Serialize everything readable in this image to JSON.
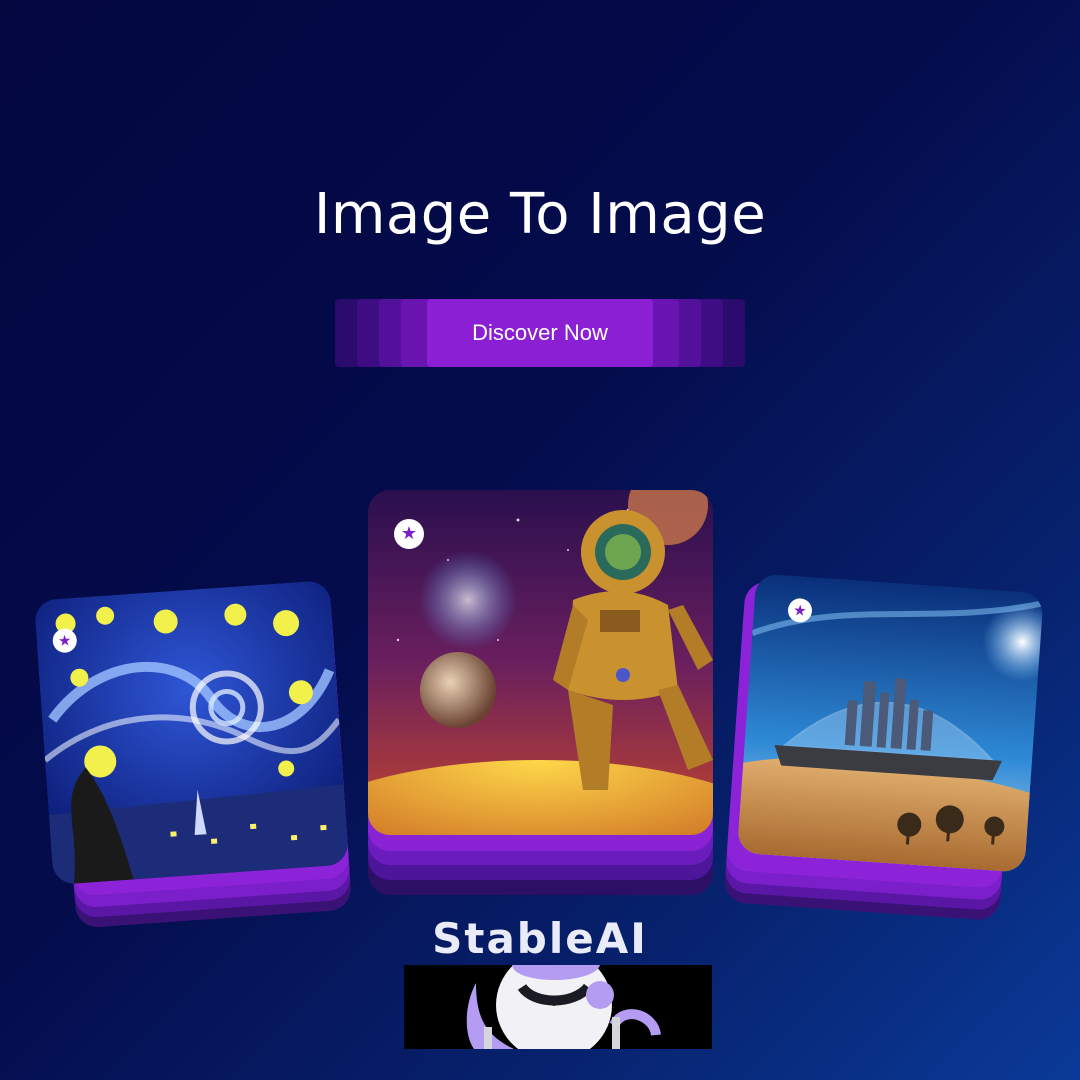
{
  "hero": {
    "title": "Image To Image",
    "cta_label": "Discover Now"
  },
  "gallery": {
    "cards": [
      {
        "name": "starry-night",
        "badge_icon": "star-icon"
      },
      {
        "name": "astronaut-space",
        "badge_icon": "star-icon"
      },
      {
        "name": "domed-desert-city",
        "badge_icon": "star-icon"
      }
    ]
  },
  "brand": {
    "name": "StableAI",
    "mascot_icon": "robot-icon"
  },
  "colors": {
    "background_dark": "#03063f",
    "background_light": "#0a3a98",
    "accent_purple": "#8a1fd3",
    "text": "#ffffff"
  }
}
